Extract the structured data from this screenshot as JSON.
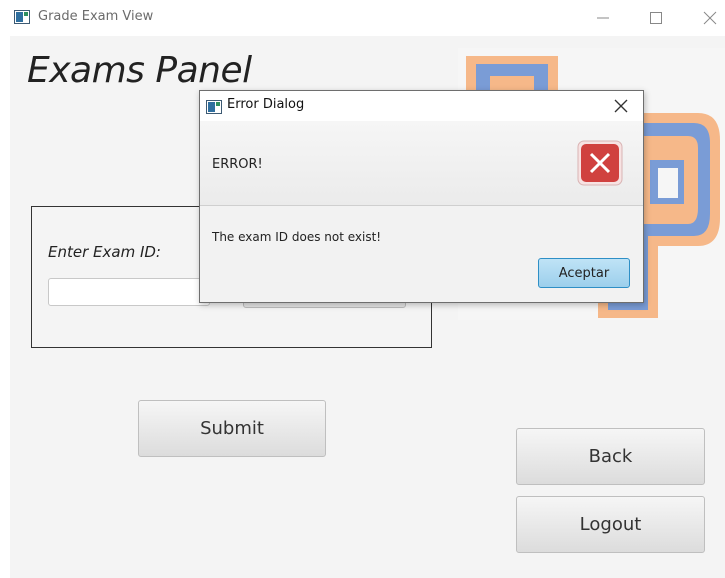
{
  "window": {
    "title": "Grade Exam View",
    "controls": [
      "minimize-icon",
      "maximize-icon",
      "close-icon"
    ]
  },
  "panel": {
    "title": "Exams Panel",
    "exam_id_label": "Enter Exam ID:",
    "exam_id_value": "",
    "submit_label": "Submit",
    "back_label": "Back",
    "logout_label": "Logout"
  },
  "dialog": {
    "title": "Error Dialog",
    "header": "ERROR!",
    "message": "The exam ID does not exist!",
    "ok_label": "Aceptar",
    "icon": "error-x-icon"
  },
  "colors": {
    "logo_orange": "#f6b889",
    "logo_blue": "#7a9cd6",
    "error_red": "#d0413f",
    "ok_blue": "#9ccfec"
  }
}
